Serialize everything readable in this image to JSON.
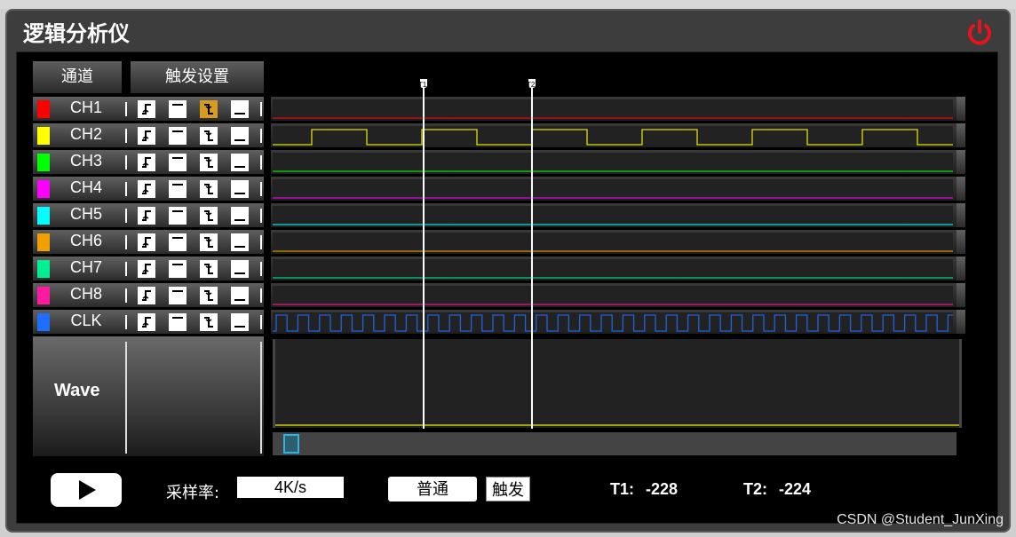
{
  "app": {
    "title": "逻辑分析仪"
  },
  "tabs": [
    {
      "label": "通道"
    },
    {
      "label": "触发设置"
    }
  ],
  "channels": [
    {
      "name": "CH1",
      "color": "#ff0000",
      "active_trigger": "falling"
    },
    {
      "name": "CH2",
      "color": "#ffff00",
      "active_trigger": "none"
    },
    {
      "name": "CH3",
      "color": "#00ff00",
      "active_trigger": "none"
    },
    {
      "name": "CH4",
      "color": "#ff00ff",
      "active_trigger": "none"
    },
    {
      "name": "CH5",
      "color": "#00ffff",
      "active_trigger": "none"
    },
    {
      "name": "CH6",
      "color": "#f0a000",
      "active_trigger": "none"
    },
    {
      "name": "CH7",
      "color": "#00f090",
      "active_trigger": "none"
    },
    {
      "name": "CH8",
      "color": "#ff1aa0",
      "active_trigger": "none"
    },
    {
      "name": "CLK",
      "color": "#1e6fff",
      "active_trigger": "none"
    }
  ],
  "trigger_icons": [
    "rising-edge-icon",
    "high-level-icon",
    "falling-edge-icon",
    "low-level-icon"
  ],
  "wave_panel": {
    "label": "Wave"
  },
  "cursors": [
    {
      "name": "T1"
    },
    {
      "name": "T2"
    }
  ],
  "controls": {
    "sample_rate_label": "采样率:",
    "sample_rate_value": "4K/s",
    "mode_value": "普通",
    "trigger_button": "触发",
    "t1_label": "T1:",
    "t1_value": "-228",
    "t2_label": "T2:",
    "t2_value": "-224"
  },
  "watermark": "CSDN @Student_JunXing"
}
